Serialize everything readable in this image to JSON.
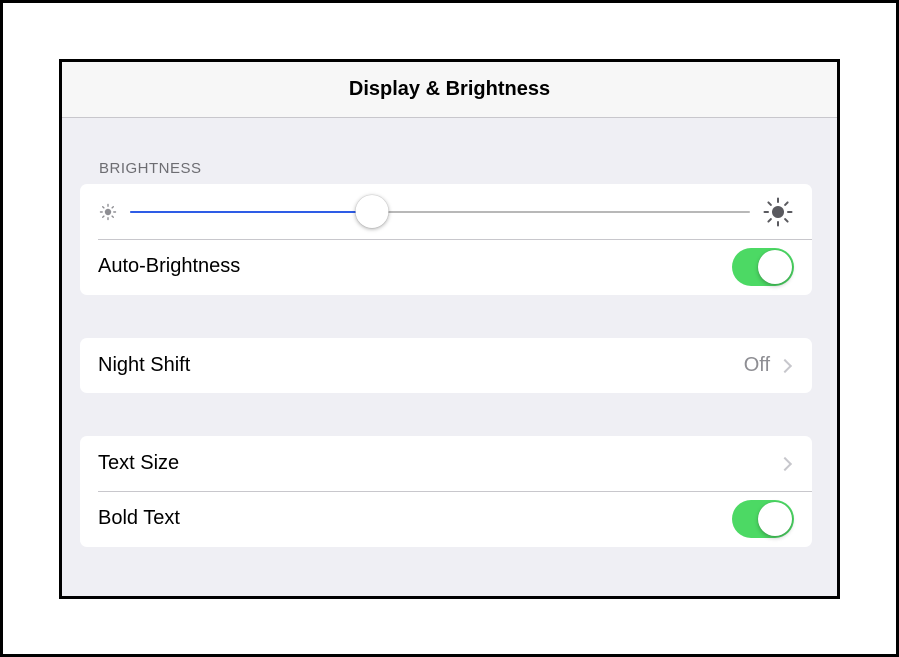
{
  "navbar": {
    "title": "Display & Brightness"
  },
  "brightness": {
    "header": "BRIGHTNESS",
    "slider_value": 0.39,
    "auto_label": "Auto-Brightness",
    "auto_on": true
  },
  "night_shift": {
    "label": "Night Shift",
    "value": "Off"
  },
  "text": {
    "size_label": "Text Size",
    "bold_label": "Bold Text",
    "bold_on": true
  },
  "colors": {
    "accent": "#2e5ce6",
    "toggle_on": "#4cd964",
    "background": "#efeff4"
  },
  "icons": [
    "sun-small-icon",
    "sun-large-icon",
    "chevron-right-icon"
  ]
}
